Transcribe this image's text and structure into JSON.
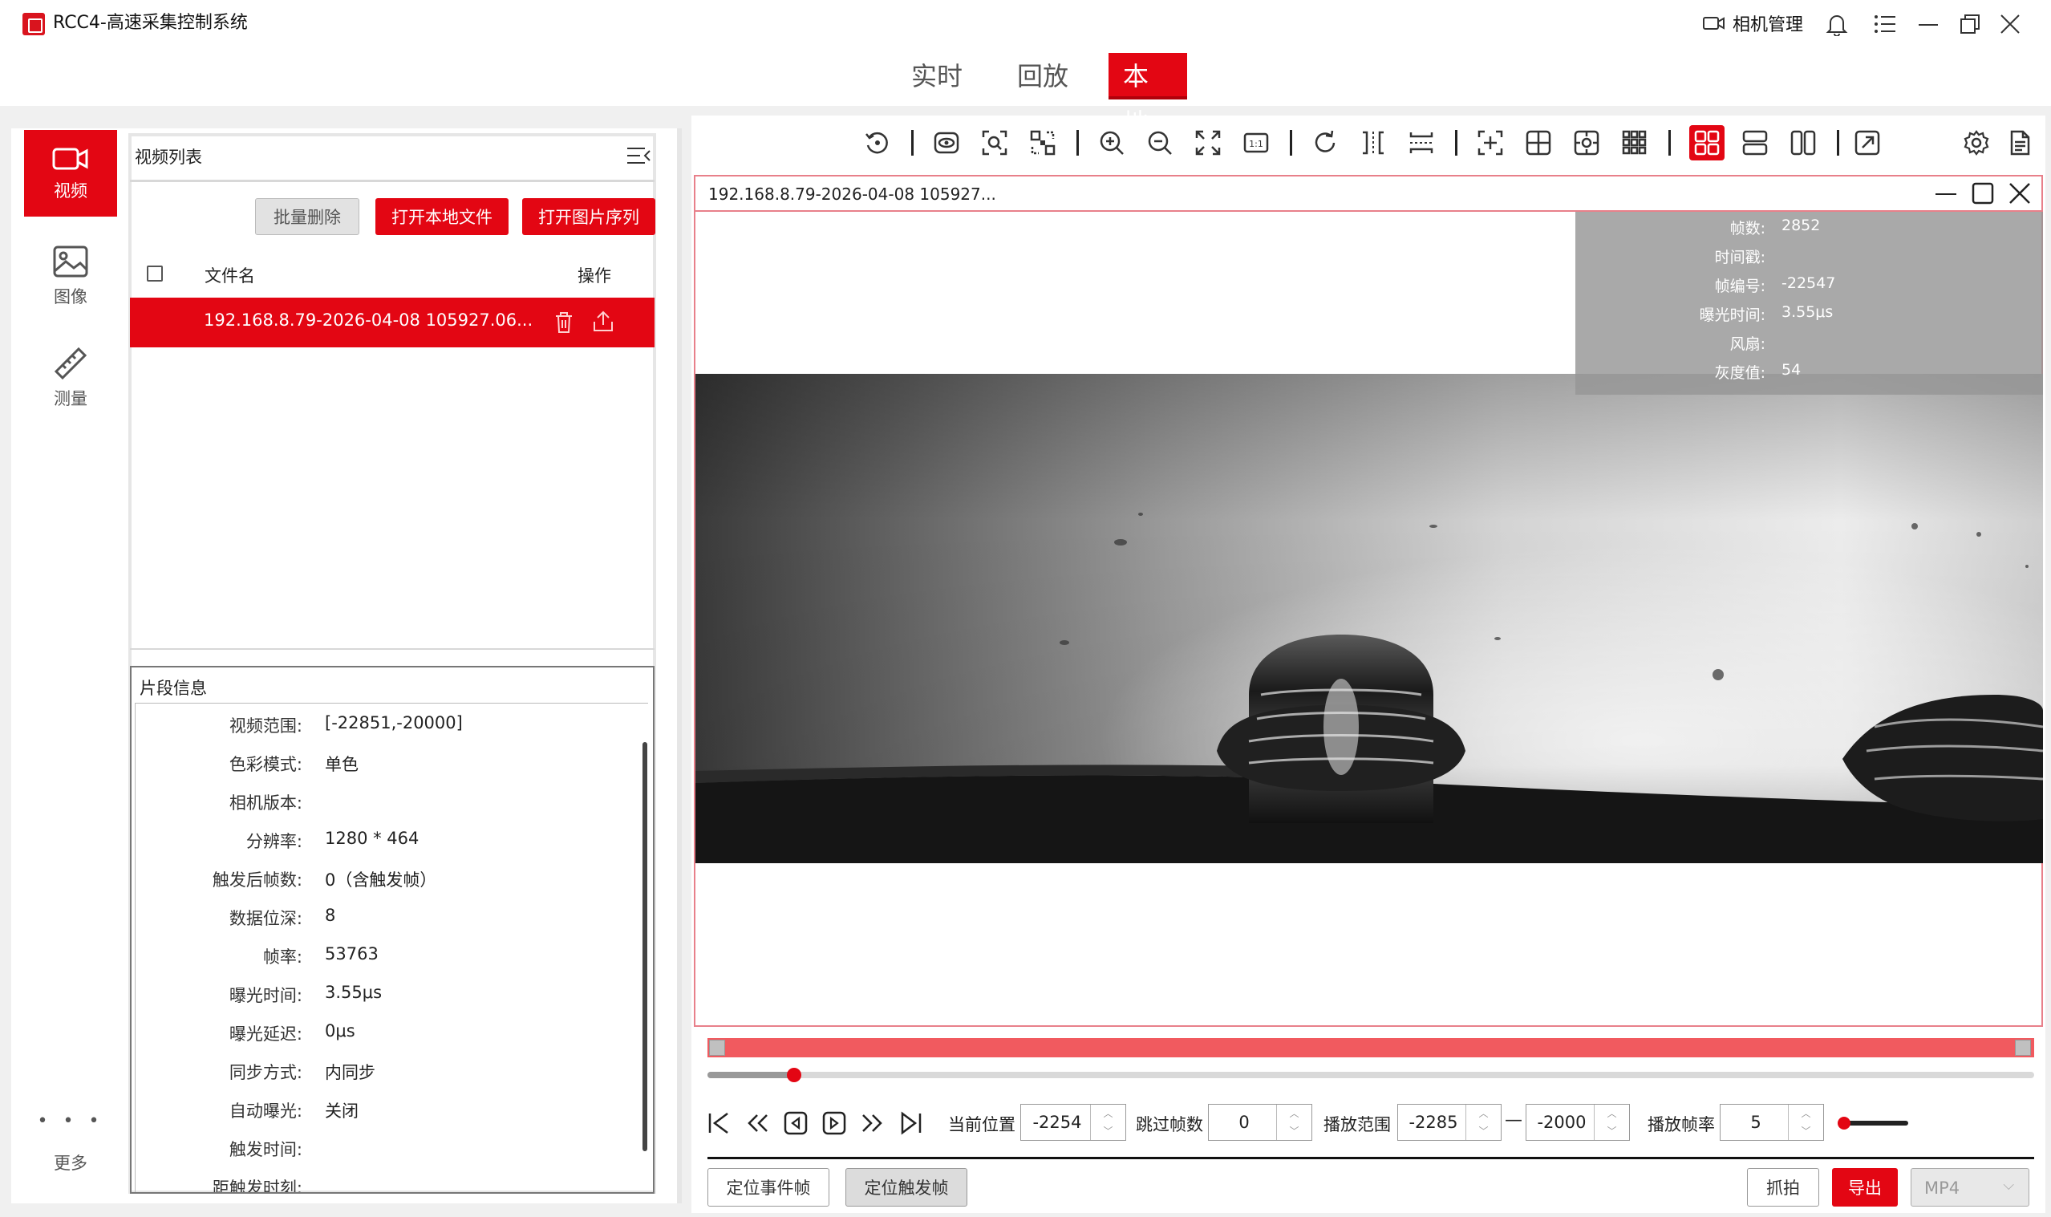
{
  "app": {
    "title": "RCC4-高速采集控制系统",
    "camera_manage": "相机管理"
  },
  "nav": {
    "tabs": [
      {
        "label": "实时"
      },
      {
        "label": "回放"
      },
      {
        "label": "本地",
        "active": true
      }
    ]
  },
  "rail": {
    "items": [
      {
        "label": "视频",
        "icon": "video-icon",
        "active": true
      },
      {
        "label": "图像",
        "icon": "image-icon"
      },
      {
        "label": "测量",
        "icon": "ruler-icon"
      }
    ],
    "more_label": "更多",
    "more_glyph": "• • •"
  },
  "video_list": {
    "title": "视频列表",
    "buttons": {
      "batch_delete": "批量删除",
      "open_local": "打开本地文件",
      "open_sequence": "打开图片序列"
    },
    "columns": {
      "name": "文件名",
      "action": "操作"
    },
    "files": [
      {
        "name": "192.168.8.79-2026-04-08 105927.06...",
        "selected": true
      }
    ]
  },
  "segment_info": {
    "title": "片段信息",
    "rows": [
      {
        "label": "视频范围:",
        "value": "[-22851,-20000]"
      },
      {
        "label": "色彩模式:",
        "value": "单色"
      },
      {
        "label": "相机版本:",
        "value": ""
      },
      {
        "label": "分辨率:",
        "value": "1280 * 464"
      },
      {
        "label": "触发后帧数:",
        "value": "0（含触发帧）"
      },
      {
        "label": "数据位深:",
        "value": "8"
      },
      {
        "label": "帧率:",
        "value": "53763"
      },
      {
        "label": "曝光时间:",
        "value": "3.55μs"
      },
      {
        "label": "曝光延迟:",
        "value": "0μs"
      },
      {
        "label": "同步方式:",
        "value": "内同步"
      },
      {
        "label": "自动曝光:",
        "value": "关闭"
      },
      {
        "label": "触发时间:",
        "value": ""
      },
      {
        "label": "距触发时刻:",
        "value": ""
      }
    ]
  },
  "viewer": {
    "title": "192.168.8.79-2026-04-08 105927...",
    "overlay": [
      {
        "key": "帧数:",
        "value": "2852"
      },
      {
        "key": "时间戳:",
        "value": ""
      },
      {
        "key": "帧编号:",
        "value": "-22547"
      },
      {
        "key": "曝光时间:",
        "value": "3.55μs"
      },
      {
        "key": "风扇:",
        "value": ""
      },
      {
        "key": "灰度值:",
        "value": "54"
      }
    ]
  },
  "toolbar": {
    "icons": [
      "reset-icon",
      "eye-icon",
      "zoom-fit-icon",
      "roi-icon",
      "zoom-in-icon",
      "zoom-out-icon",
      "fullscreen-icon",
      "one-to-one-icon",
      "rotate-icon",
      "flip-horizontal-icon",
      "flip-vertical-icon",
      "crosshair-icon",
      "grid-2x2-icon",
      "center-target-icon",
      "grid-3x3-icon",
      "layout-quad-icon",
      "layout-rows-icon",
      "layout-columns-icon",
      "external-link-icon",
      "settings-icon",
      "document-icon"
    ],
    "active_icon": "layout-quad-icon"
  },
  "playback": {
    "progress_fraction": 0.065,
    "current_position_label": "当前位置",
    "current_position_value": "-2254",
    "skip_frames_label": "跳过帧数",
    "skip_frames_value": "0",
    "play_range_label": "播放范围",
    "range_start_value": "-2285",
    "range_end_value": "-2000",
    "range_separator": "—",
    "play_rate_label": "播放帧率",
    "play_rate_value": "5",
    "volume_fraction": 0.0
  },
  "actions": {
    "locate_event": "定位事件帧",
    "locate_trigger": "定位触发帧",
    "capture": "抓拍",
    "export": "导出",
    "format": "MP4"
  },
  "colors": {
    "accent": "#e30613",
    "timeline": "#f15a5f"
  }
}
